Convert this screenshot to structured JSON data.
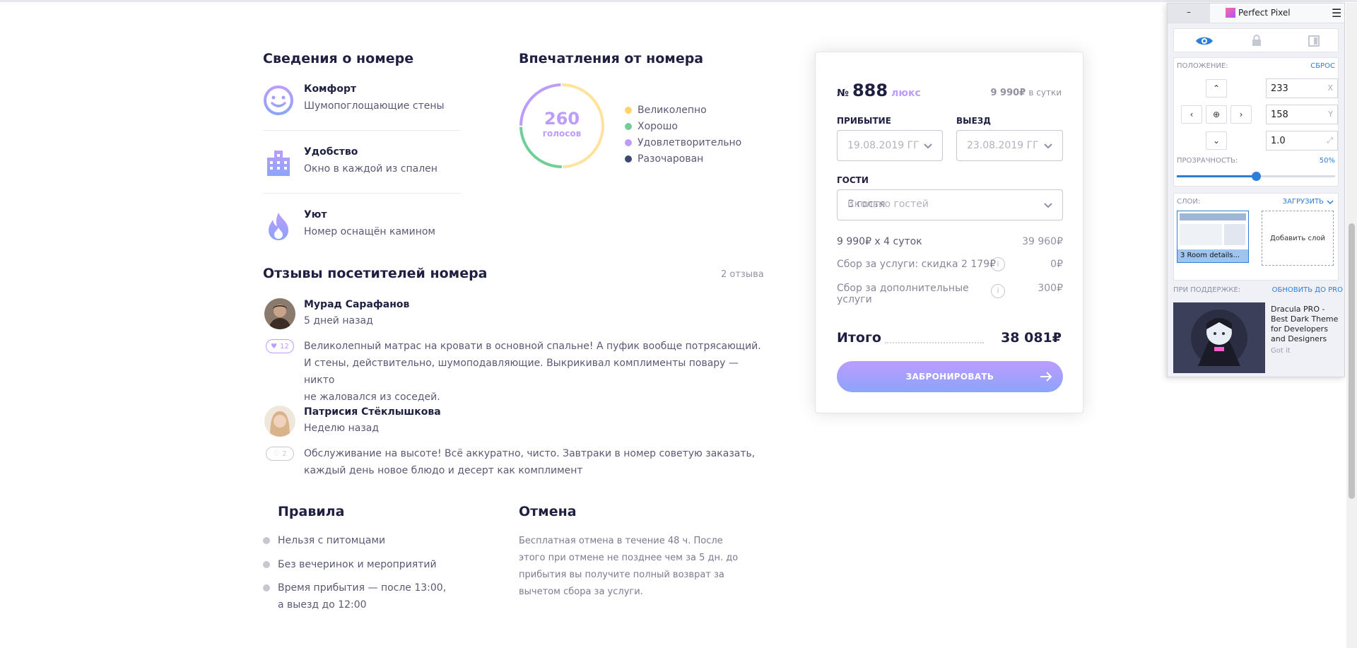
{
  "room_details": {
    "title": "Сведения о номере",
    "features": [
      {
        "title": "Комфорт",
        "desc": "Шумопоглощающие стены",
        "icon": "smile-icon"
      },
      {
        "title": "Удобство",
        "desc": "Окно в каждой из спален",
        "icon": "building-icon"
      },
      {
        "title": "Уют",
        "desc": "Номер оснащён камином",
        "icon": "fire-icon"
      }
    ]
  },
  "impressions": {
    "title": "Впечатления от номера",
    "votes": "260",
    "votes_label": "голосов",
    "legend": [
      {
        "label": "Великолепно",
        "color": "#ffe39c",
        "value": 130
      },
      {
        "label": "Хорошо",
        "color": "#6fcf97",
        "value": 65
      },
      {
        "label": "Удовлетворительно",
        "color": "#bc9cff",
        "value": 65
      },
      {
        "label": "Разочарован",
        "color": "#3d4975",
        "value": 0
      }
    ]
  },
  "reviews": {
    "title": "Отзывы посетителей номера",
    "count": "2 отзыва",
    "items": [
      {
        "name": "Мурад Сарафанов",
        "date": "5 дней назад",
        "likes": "12",
        "lines": [
          "Великолепный матрас на кровати в основной спальне! А пуфик вообще потрясающий.",
          "И стены, действительно, шумоподавляющие. Выкрикивал комплименты повару — никто",
          "не жаловался из соседей."
        ]
      },
      {
        "name": "Патрисия Стёклышкова",
        "date": "Неделю назад",
        "likes": "2",
        "lines": [
          "Обслуживание на высоте! Всё аккуратно, чисто. Завтраки в номер советую заказать,",
          "каждый день новое блюдо и десерт как комплимент"
        ]
      }
    ]
  },
  "rules": {
    "title": "Правила",
    "items": [
      "Нельзя с питомцами",
      "Без вечеринок и мероприятий",
      "Время прибытия — после 13:00,",
      "а выезд до 12:00"
    ]
  },
  "cancel": {
    "title": "Отмена",
    "lines": [
      "Бесплатная отмена в течение 48 ч. После",
      "этого при отмене не позднее чем за 5 дн. до",
      "прибытия вы получите полный возврат за",
      "вычетом сбора за услуги."
    ]
  },
  "booking": {
    "number_prefix": "№",
    "number": "888",
    "room_type": "люкс",
    "price": "9 990₽",
    "price_unit": "в сутки",
    "arrival_label": "Прибытие",
    "arrival_value": "19.08.2019",
    "arrival_suffix": "ГГ",
    "departure_label": "Выезд",
    "departure_value": "23.08.2019",
    "departure_suffix": "ГГ",
    "guests_label": "Гости",
    "guests_placeholder": "Сколько гостей",
    "guests_value": "3 гостя",
    "rows": [
      {
        "label": "9 990₽ х 4 суток",
        "amount": "39 960₽",
        "info": false
      },
      {
        "label": "Сбор за услуги: скидка 2 179₽",
        "amount": "0₽",
        "info": true
      },
      {
        "label": "Сбор за дополнительные услуги",
        "amount": "300₽",
        "info": true
      }
    ],
    "total_label": "Итого",
    "total_value": "38 081₽",
    "button": "Забронировать"
  },
  "perfect_pixel": {
    "minimize": "–",
    "title": "Perfect Pixel",
    "position_label": "Положение:",
    "reset": "Сброс",
    "x_value": "233",
    "y_value": "158",
    "scale_value": "1.0",
    "x_axis": "X",
    "y_axis": "Y",
    "opacity_label": "Прозрачность:",
    "opacity_value": "50%",
    "opacity_fraction": 0.5,
    "layers_label": "Слои:",
    "upload": "Загрузить",
    "layer_name": "3 Room details...",
    "add_layer": "Добавить слой",
    "support_label": "При поддержке:",
    "upgrade": "Обновить до PRO",
    "ad_title": "Dracula PRO - Best Dark Theme for Developers and Designers",
    "ad_link": "Got it"
  }
}
